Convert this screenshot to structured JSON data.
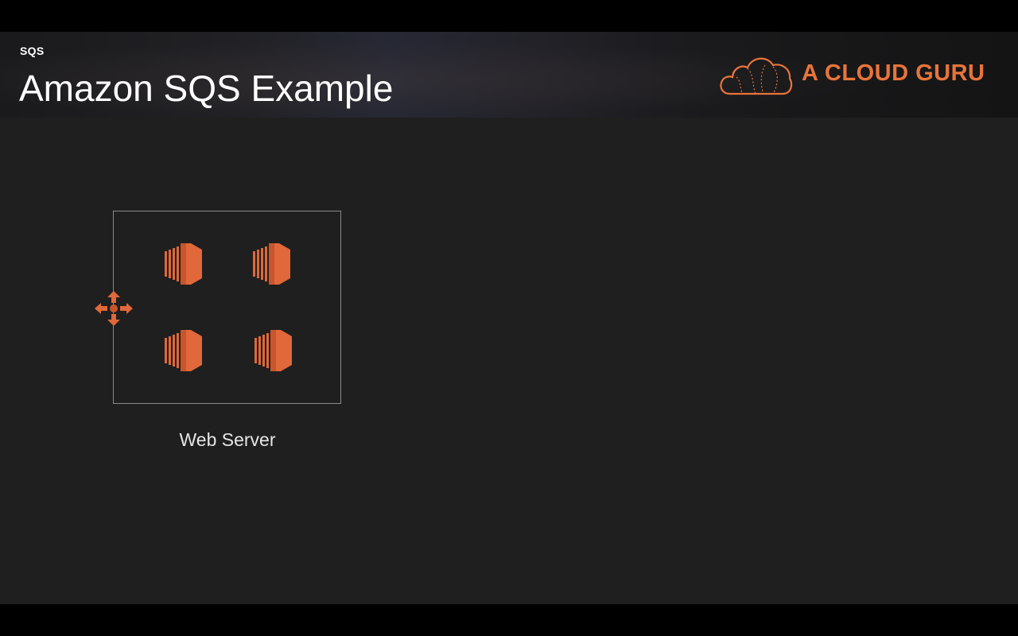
{
  "header": {
    "section_label": "SQS",
    "title": "Amazon SQS Example"
  },
  "logo": {
    "text": "A CLOUD GURU",
    "icon": "cloud-icon",
    "color": "#e8743a"
  },
  "diagram": {
    "group_label": "Web Server",
    "load_balancer_icon": "load-balancer-icon",
    "instance_icon": "ec2-instance-icon",
    "instance_count": 4,
    "accent_color": "#e0683a"
  }
}
